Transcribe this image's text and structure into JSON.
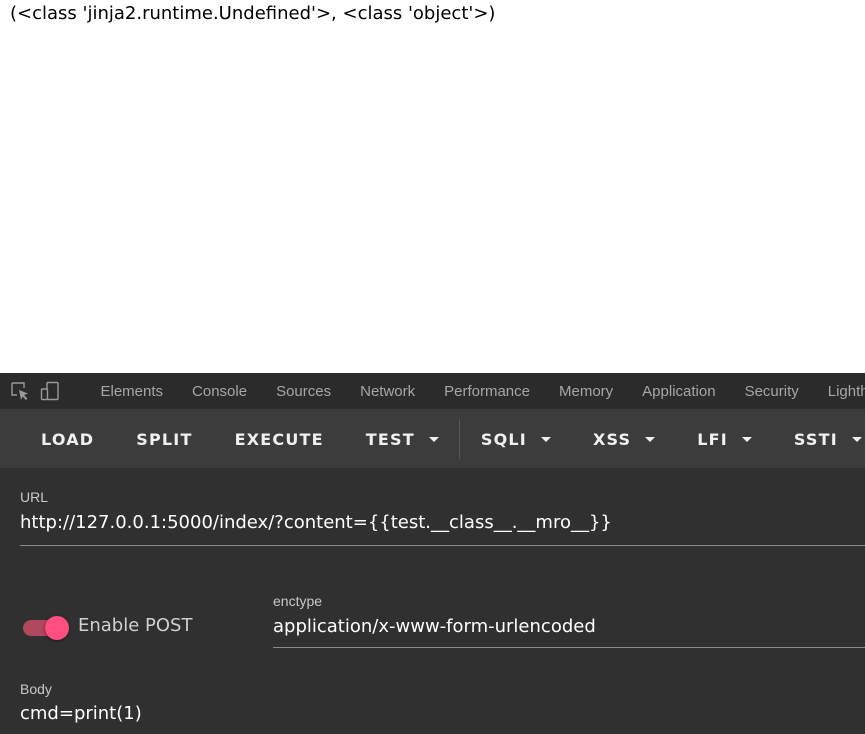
{
  "page": {
    "output_text": "(<class 'jinja2.runtime.Undefined'>, <class 'object'>)"
  },
  "devtools": {
    "tools": [
      {
        "icon": "inspect-element-icon"
      },
      {
        "icon": "device-toggle-icon"
      }
    ],
    "tabs": [
      "Elements",
      "Console",
      "Sources",
      "Network",
      "Performance",
      "Memory",
      "Application",
      "Security",
      "Lighth"
    ]
  },
  "hackbar": {
    "buttons": [
      {
        "label": "LOAD",
        "dropdown": false
      },
      {
        "label": "SPLIT",
        "dropdown": false
      },
      {
        "label": "EXECUTE",
        "dropdown": false
      },
      {
        "label": "TEST",
        "dropdown": true
      },
      {
        "label": "SQLI",
        "dropdown": true
      },
      {
        "label": "XSS",
        "dropdown": true
      },
      {
        "label": "LFI",
        "dropdown": true
      },
      {
        "label": "SSTI",
        "dropdown": true
      }
    ],
    "url": {
      "label": "URL",
      "value": "http://127.0.0.1:5000/index/?content={{test.__class__.__mro__}}"
    },
    "post": {
      "toggle_label": "Enable POST",
      "enabled": true
    },
    "enctype": {
      "label": "enctype",
      "value": "application/x-www-form-urlencoded"
    },
    "body": {
      "label": "Body",
      "value": "cmd=print(1)"
    }
  },
  "colors": {
    "toggle_accent": "#ff4f80",
    "toolbar_bg": "#3c3c3c",
    "panel_bg": "#303030"
  }
}
